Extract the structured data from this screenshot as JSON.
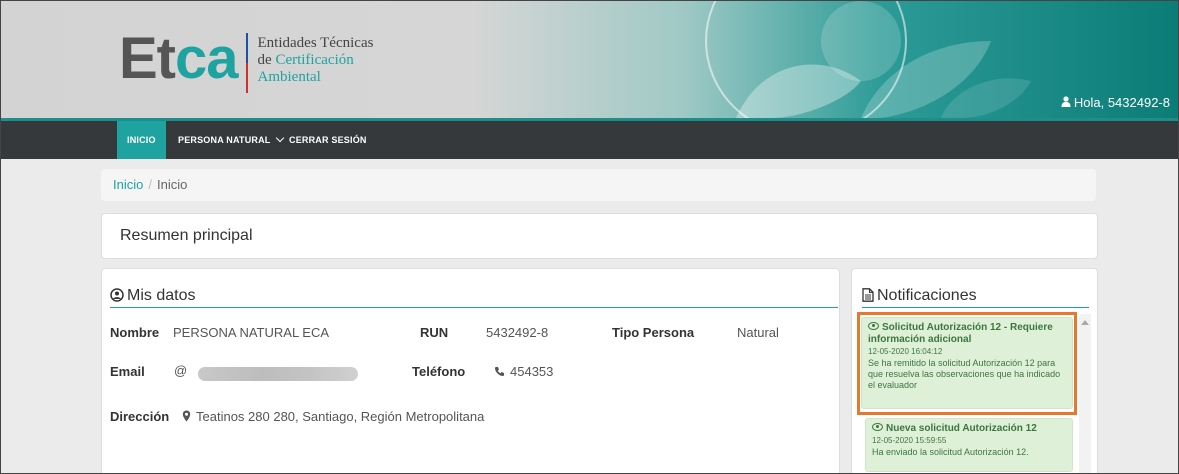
{
  "header": {
    "logo_word_e": "Et",
    "logo_word_ca": "ca",
    "logo_line1": "Entidades Técnicas",
    "logo_line2_a": "de ",
    "logo_line2_b": "Certificación",
    "logo_line3": "Ambiental",
    "greeting": "Hola, 5432492-8"
  },
  "nav": {
    "inicio": "INICIO",
    "persona": "PERSONA NATURAL",
    "cerrar": "CERRAR SESIÓN"
  },
  "breadcrumb": {
    "link": "Inicio",
    "separator": "/",
    "current": "Inicio"
  },
  "resumen": {
    "title": "Resumen principal"
  },
  "misdatos": {
    "title": "Mis datos",
    "nombre_label": "Nombre",
    "nombre_value": "PERSONA NATURAL ECA",
    "run_label": "RUN",
    "run_value": "5432492-8",
    "tipo_label": "Tipo Persona",
    "tipo_value": "Natural",
    "email_label": "Email",
    "email_icon": "@",
    "telefono_label": "Teléfono",
    "telefono_value": "454353",
    "direccion_label": "Dirección",
    "direccion_value": "Teatinos 280 280, Santiago, Región Metropolitana"
  },
  "notificaciones": {
    "title": "Notificaciones",
    "items": [
      {
        "title": "Solicitud Autorización 12 - Requiere información adicional",
        "date": "12-05-2020 16:04:12",
        "body": "Se ha remitido la solicitud Autorización 12 para que resuelva las observaciones que ha indicado el evaluador"
      },
      {
        "title": "Nueva solicitud Autorización 12",
        "date": "12-05-2020 15:59:55",
        "body": "Ha enviado la solicitud Autorización 12."
      }
    ]
  },
  "colors": {
    "accent": "#1fa3a0",
    "nav_bg": "#35393c",
    "notification_bg": "#dff0d8",
    "notification_text": "#3c763d",
    "highlight": "#e8782f"
  }
}
